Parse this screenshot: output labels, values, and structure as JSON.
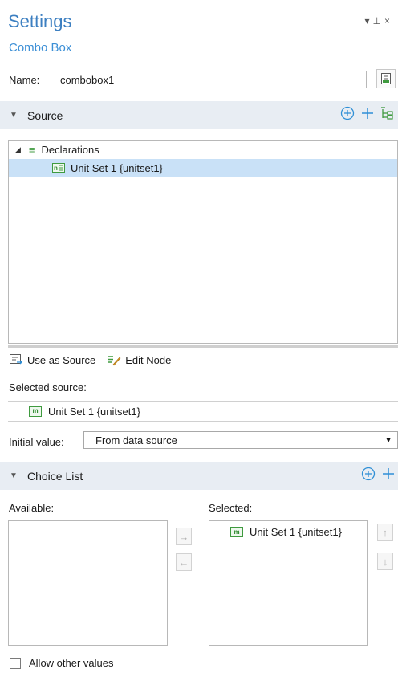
{
  "header": {
    "title": "Settings",
    "subtitle": "Combo Box",
    "window_controls": "▾ ⊥ ×"
  },
  "name_field": {
    "label": "Name:",
    "value": "combobox1"
  },
  "source_section": {
    "title": "Source",
    "tree": [
      {
        "label": "Declarations",
        "expanded": true
      },
      {
        "label": "Unit Set 1 {unitset1}",
        "selected": true
      }
    ],
    "use_as_source": "Use as Source",
    "edit_node": "Edit Node",
    "selected_source_label": "Selected source:",
    "selected_source_value": "Unit Set 1 {unitset1}",
    "initial_value_label": "Initial value:",
    "initial_value": "From data source"
  },
  "choice_section": {
    "title": "Choice List",
    "available_label": "Available:",
    "selected_label": "Selected:",
    "selected_items": [
      "Unit Set 1 {unitset1}"
    ],
    "allow_other_values": "Allow other values"
  },
  "colors": {
    "title": "#3c7fc1",
    "accent": "#2f8fd6",
    "section_bg": "#e8edf3",
    "selection": "#c9e1f7"
  }
}
